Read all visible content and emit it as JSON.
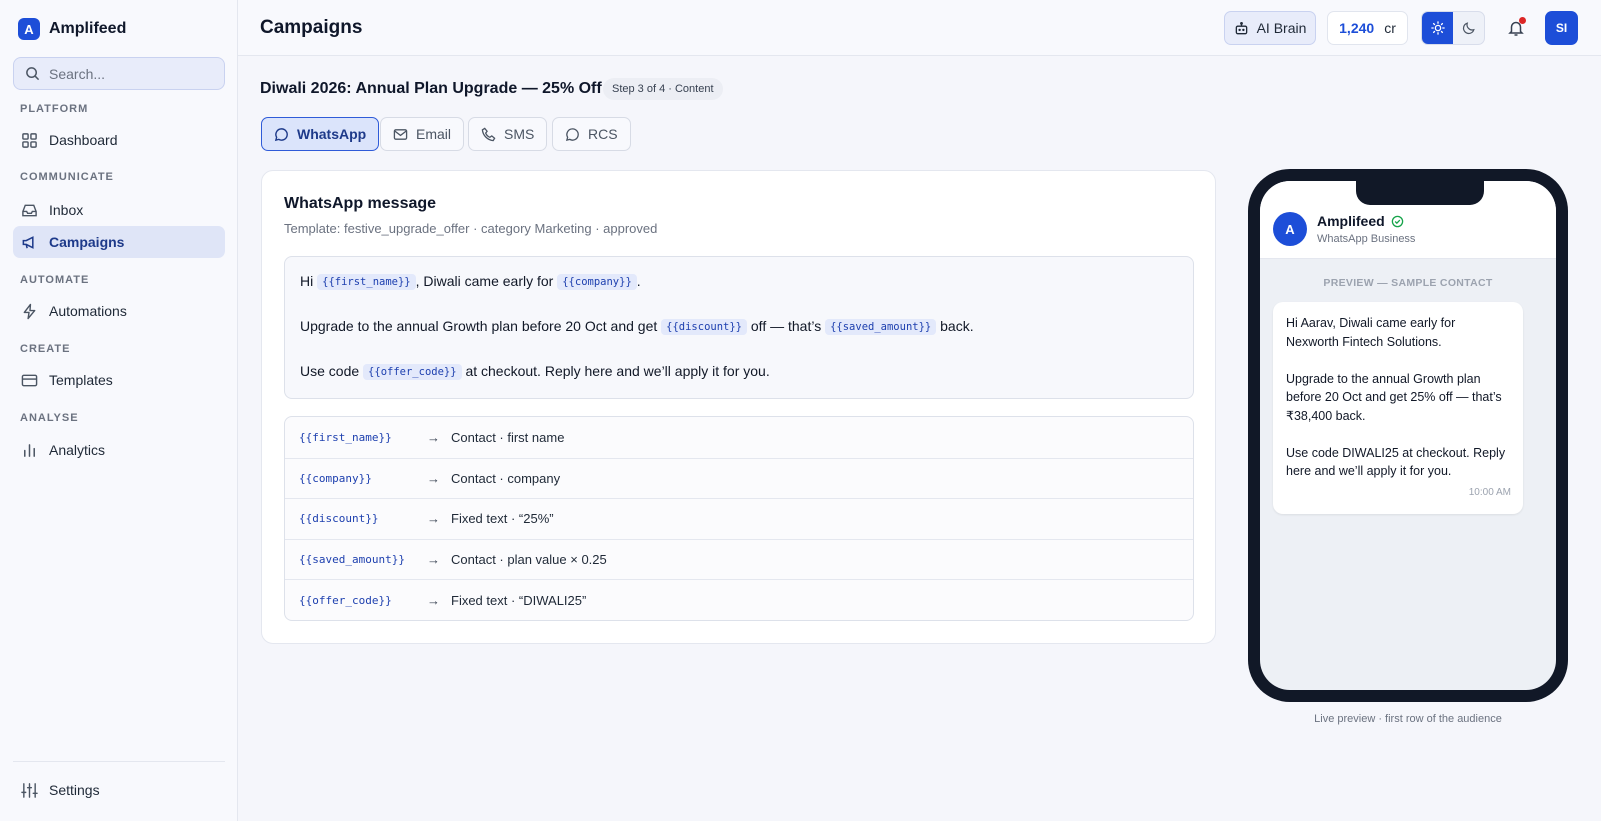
{
  "brand": {
    "logo_letter": "A",
    "name": "Amplifeed"
  },
  "search": {
    "placeholder": "Search..."
  },
  "nav": {
    "sections": [
      "PLATFORM",
      "COMMUNICATE",
      "AUTOMATE",
      "CREATE",
      "ANALYSE"
    ],
    "items": [
      {
        "label": "Dashboard",
        "icon": "grid-icon"
      },
      {
        "label": "Inbox",
        "icon": "inbox-icon"
      },
      {
        "label": "Campaigns",
        "icon": "megaphone-icon",
        "active": true
      },
      {
        "label": "Automations",
        "icon": "lightning-icon"
      },
      {
        "label": "Templates",
        "icon": "card-icon"
      },
      {
        "label": "Analytics",
        "icon": "bar-chart-icon"
      }
    ],
    "settings_label": "Settings"
  },
  "header": {
    "title": "Campaigns",
    "ai_brain_label": "AI Brain",
    "credits_value": "1,240",
    "credits_unit": "cr",
    "avatar_initials": "SI",
    "accent_color": "#1d4ed8",
    "notification_dot_color": "#dc2626"
  },
  "campaign": {
    "title": "Diwali 2026: Annual Plan Upgrade — 25% Off",
    "step": "Step 3 of 4 · Content",
    "tabs": [
      "WhatsApp",
      "Email",
      "SMS",
      "RCS"
    ],
    "active_tab": "WhatsApp"
  },
  "message": {
    "heading": "WhatsApp message",
    "template_meta": "Template: festive_upgrade_offer · category Marketing · approved",
    "line1": {
      "a": "Hi",
      "v1": "{{first_name}}",
      "b": ", Diwali came early for",
      "v2": "{{company}}",
      "c": "."
    },
    "line2": {
      "a": "Upgrade to the annual Growth plan before 20 Oct and get",
      "v1": "{{discount}}",
      "b": "off — that’s",
      "v2": "{{saved_amount}}",
      "c": "back."
    },
    "line3": {
      "a": "Use code",
      "v1": "{{offer_code}}",
      "b": "at checkout. Reply here and we’ll apply it for you."
    }
  },
  "variables": [
    {
      "name": "{{first_name}}",
      "arrow": "→",
      "mapping": "Contact · first name"
    },
    {
      "name": "{{company}}",
      "arrow": "→",
      "mapping": "Contact · company"
    },
    {
      "name": "{{discount}}",
      "arrow": "→",
      "mapping": "Fixed text · “25%”"
    },
    {
      "name": "{{saved_amount}}",
      "arrow": "→",
      "mapping": "Contact · plan value × 0.25"
    },
    {
      "name": "{{offer_code}}",
      "arrow": "→",
      "mapping": "Fixed text · “DIWALI25”"
    }
  ],
  "preview": {
    "avatar_letter": "A",
    "sender_name": "Amplifeed",
    "sender_sub": "WhatsApp Business",
    "label": "PREVIEW — SAMPLE CONTACT",
    "paragraphs": [
      "Hi Aarav, Diwali came early for Nexworth Fintech Solutions.",
      "Upgrade to the annual Growth plan before 20 Oct and get 25% off — that’s ₹38,400 back.",
      "Use code DIWALI25 at checkout. Reply here and we’ll apply it for you."
    ],
    "time": "10:00 AM",
    "caption": "Live preview · first row of the audience"
  }
}
